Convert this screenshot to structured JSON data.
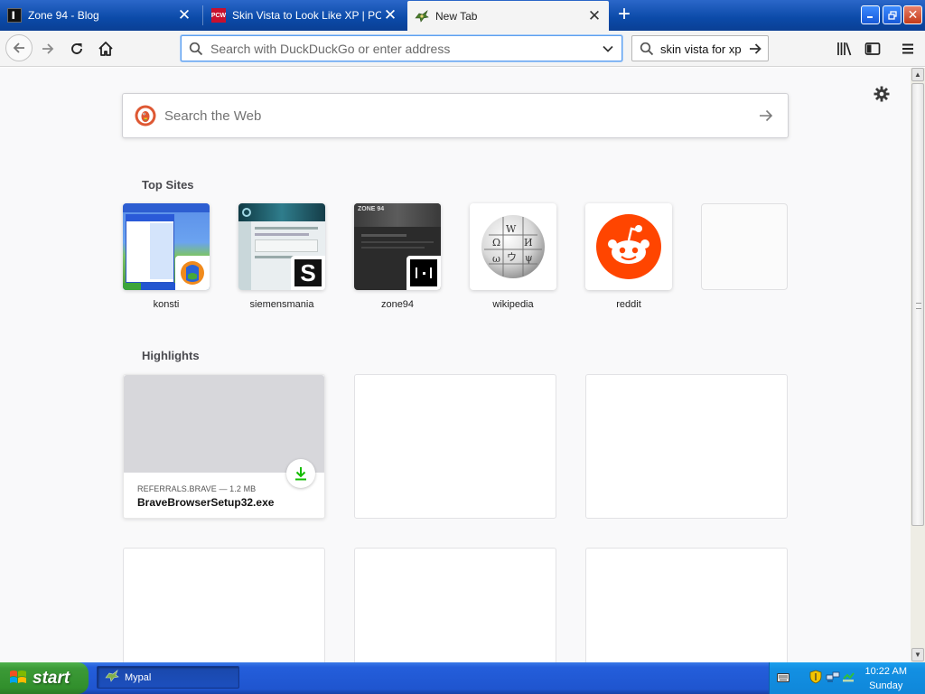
{
  "tabs": [
    {
      "title": "Zone 94 - Blog",
      "favicon": "zone94-favicon",
      "active": false
    },
    {
      "title": "Skin Vista to Look Like XP | PCW",
      "favicon": "pcw-favicon",
      "favicon_text": "PCW",
      "active": false
    },
    {
      "title": "New Tab",
      "favicon": "mypal-favicon",
      "active": true
    }
  ],
  "urlbar": {
    "placeholder": "Search with DuckDuckGo or enter address"
  },
  "searchbar": {
    "value": "skin vista for xp"
  },
  "content": {
    "websearch_placeholder": "Search the Web",
    "top_sites_heading": "Top Sites",
    "top_sites": [
      {
        "label": "konsti"
      },
      {
        "label": "siemensmania"
      },
      {
        "label": "zone94"
      },
      {
        "label": "wikipedia"
      },
      {
        "label": "reddit"
      },
      {
        "label": ""
      }
    ],
    "highlights_heading": "Highlights",
    "highlights": [
      {
        "meta": "REFERRALS.BRAVE — 1.2 MB",
        "filename": "BraveBrowserSetup32.exe"
      }
    ]
  },
  "taskbar": {
    "start_label": "start",
    "window_title": "Mypal",
    "clock_time": "10:22 AM",
    "clock_day": "Sunday"
  },
  "colors": {
    "accent": "#0a64d2",
    "taskbar": "#245edb",
    "start_green": "#3c9a37",
    "reddit": "#ff4500",
    "download_green": "#12bc00"
  }
}
